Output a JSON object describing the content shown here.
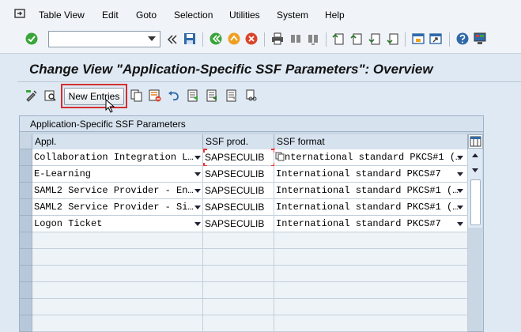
{
  "menubar": {
    "items": [
      "Table View",
      "Edit",
      "Goto",
      "Selection",
      "Utilities",
      "System",
      "Help"
    ]
  },
  "toolbar": {
    "command_value": "",
    "icons": [
      "enter-check-icon",
      "save-icon",
      "back-icon",
      "exit-icon",
      "cancel-icon",
      "print-icon",
      "find-icon",
      "find-next-icon",
      "first-page-icon",
      "prev-page-icon",
      "next-page-icon",
      "last-page-icon",
      "new-session-icon",
      "shortcut-icon",
      "help-icon",
      "settings-icon"
    ]
  },
  "page": {
    "title": "Change View \"Application-Specific SSF Parameters\": Overview"
  },
  "app_toolbar": {
    "new_entries_label": "New Entries"
  },
  "table": {
    "caption": "Application-Specific SSF Parameters",
    "columns": [
      "Appl.",
      "SSF prod.",
      "SSF format"
    ],
    "rows": [
      {
        "appl": "Collaboration Integration L…",
        "prod": "SAPSECULIB",
        "format": "nternational standard PKCS#1 (…"
      },
      {
        "appl": "E-Learning",
        "prod": "SAPSECULIB",
        "format": "International standard PKCS#7"
      },
      {
        "appl": "SAML2 Service Provider - En…",
        "prod": "SAPSECULIB",
        "format": "International standard PKCS#1 (…"
      },
      {
        "appl": "SAML2 Service Provider - Si…",
        "prod": "SAPSECULIB",
        "format": "International standard PKCS#1 (…"
      },
      {
        "appl": "Logon Ticket",
        "prod": "SAPSECULIB",
        "format": "International standard PKCS#7"
      }
    ]
  },
  "colors": {
    "accent_green": "#3aa53a",
    "highlight_red": "#d32f2f",
    "sap_blue": "#dfe9f3"
  }
}
